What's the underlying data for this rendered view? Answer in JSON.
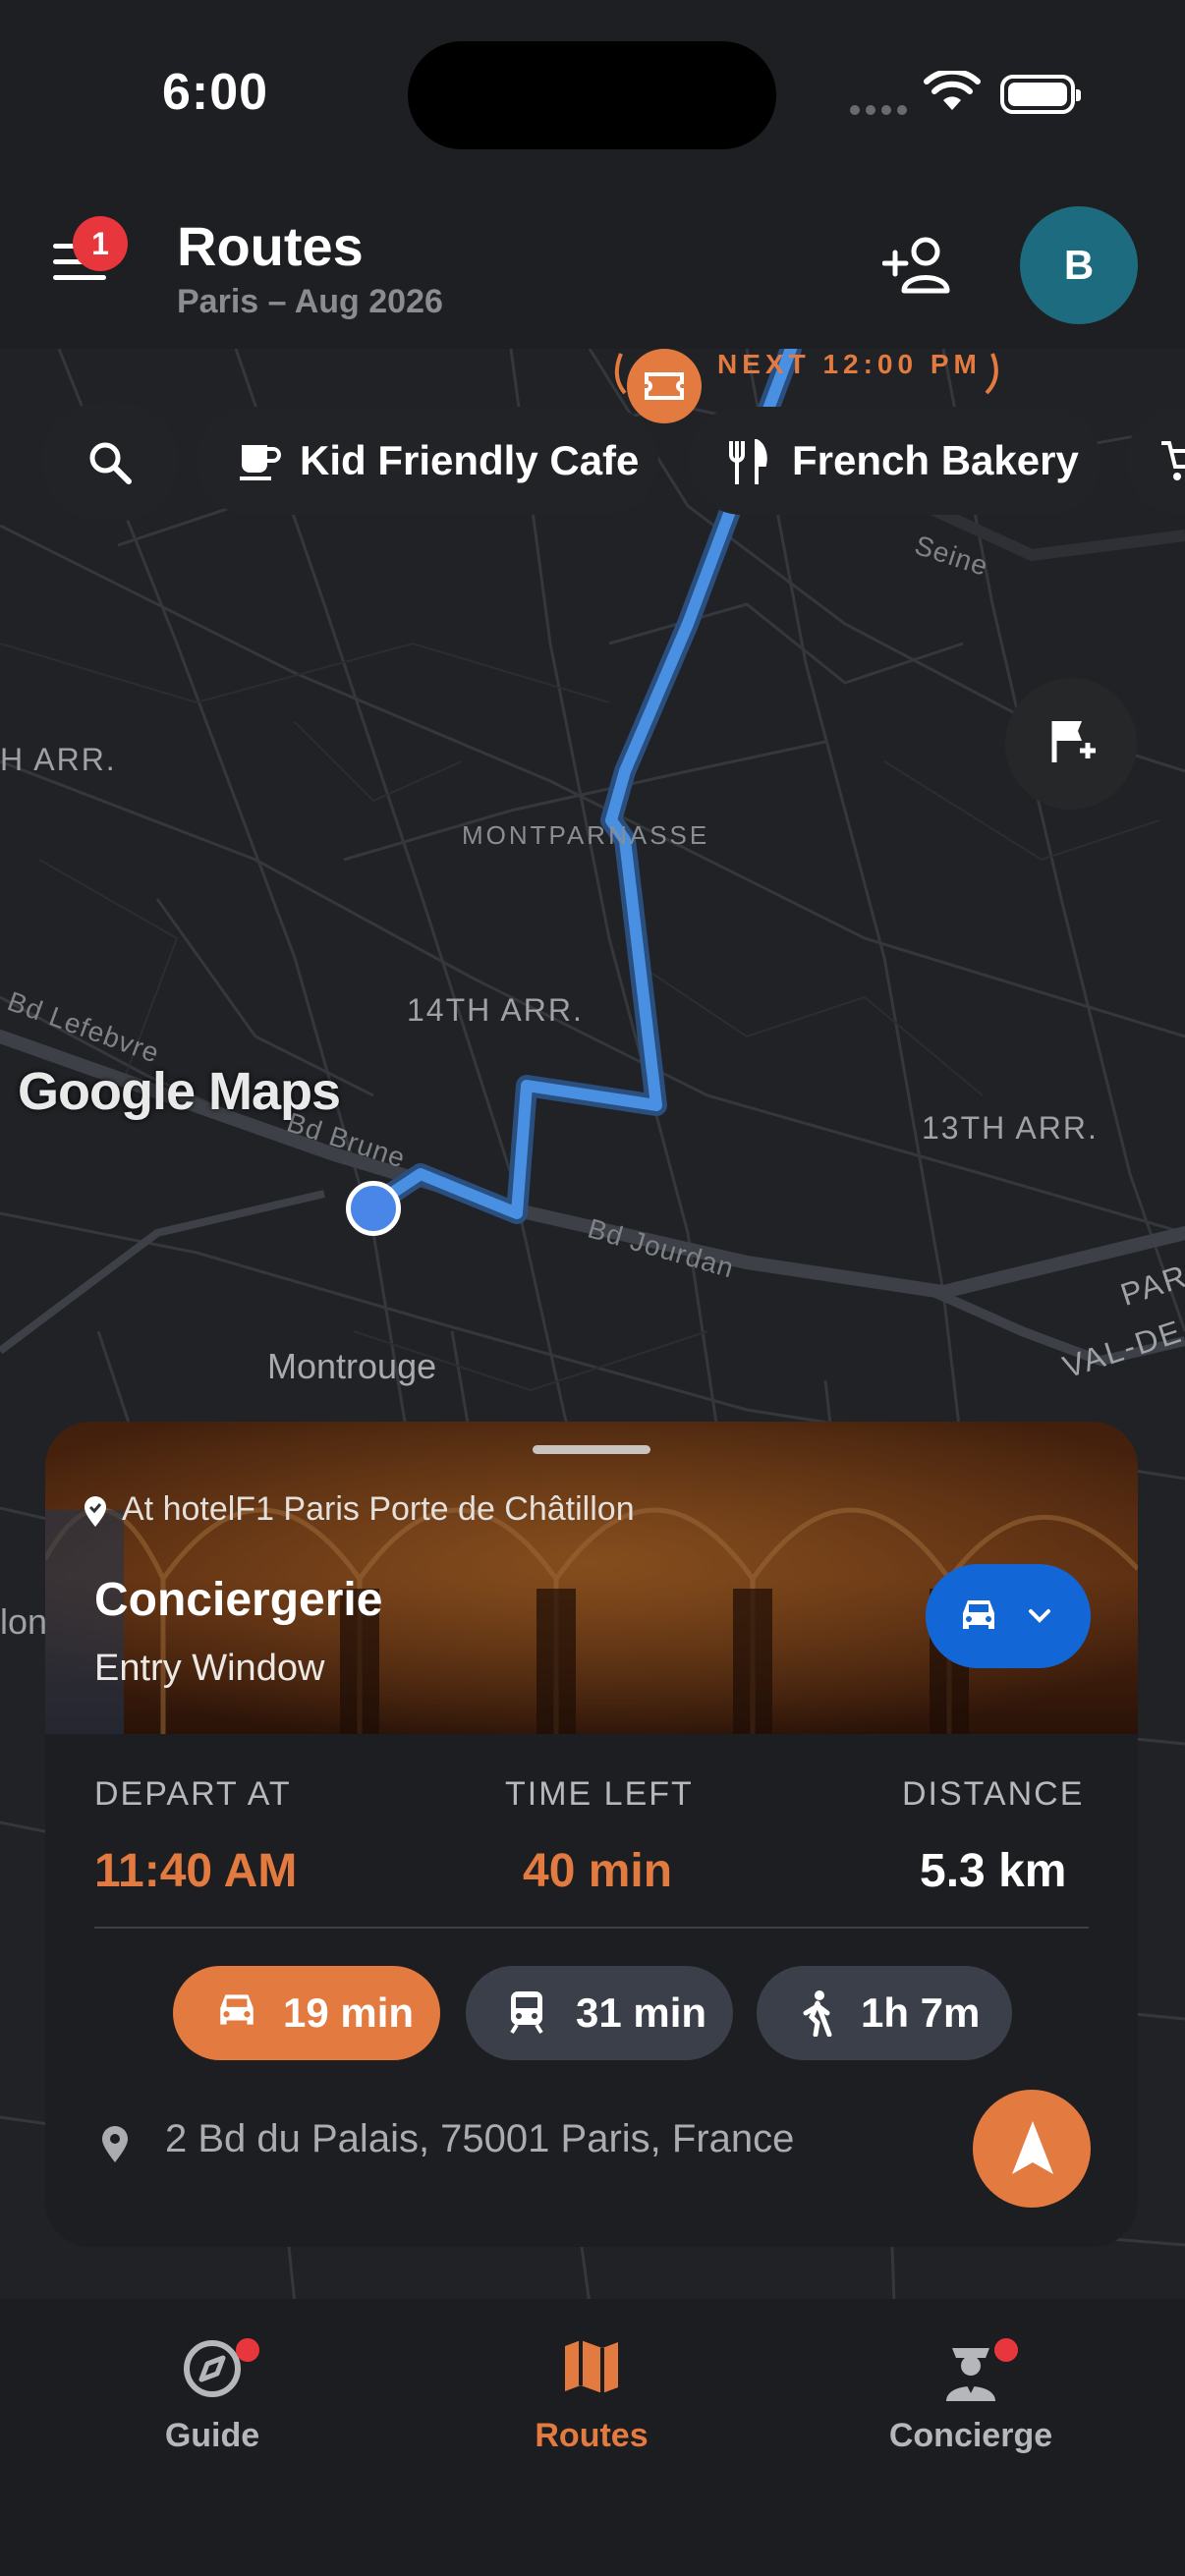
{
  "status_bar": {
    "time": "6:00"
  },
  "header": {
    "title": "Routes",
    "subtitle": "Paris – Aug 2026",
    "notification_count": "1",
    "avatar_initial": "B"
  },
  "next_event": {
    "label": "NEXT 12:00 PM"
  },
  "filter_chips": [
    {
      "label": "Kid Friendly Cafe",
      "icon": "coffee-icon"
    },
    {
      "label": "French Bakery",
      "icon": "utensils-icon"
    }
  ],
  "map": {
    "attribution": "Google Maps",
    "labels": {
      "arr_left": "H ARR.",
      "montparnasse": "MONTPARNASSE",
      "arr14": "14TH ARR.",
      "arr13": "13TH ARR.",
      "montrouge": "Montrouge",
      "seine": "Seine",
      "bd_lefebvre": "Bd Lefebvre",
      "bd_brune": "Bd Brune",
      "bd_jourdan": "Bd Jourdan",
      "par": "PAR",
      "val_de": "VAL-DE",
      "lon": "lon"
    }
  },
  "destination": {
    "start_location": "At hotelF1 Paris Porte de Châtillon",
    "name": "Conciergerie",
    "subtitle": "Entry Window",
    "mode_icon": "car-icon",
    "depart_label": "DEPART AT",
    "depart_value": "11:40 AM",
    "time_left_label": "TIME LEFT",
    "time_left_value": "40 min",
    "distance_label": "DISTANCE",
    "distance_value": "5.3 km",
    "modes": [
      {
        "icon": "car-icon",
        "label": "19 min",
        "active": true
      },
      {
        "icon": "train-icon",
        "label": "31 min",
        "active": false
      },
      {
        "icon": "walk-icon",
        "label": "1h 7m",
        "active": false
      }
    ],
    "address": "2 Bd du Palais, 75001 Paris, France"
  },
  "bottom_nav": [
    {
      "label": "Guide",
      "icon": "compass-icon",
      "active": false,
      "dot": true
    },
    {
      "label": "Routes",
      "icon": "map-icon",
      "active": true,
      "dot": false
    },
    {
      "label": "Concierge",
      "icon": "concierge-icon",
      "active": false,
      "dot": true
    }
  ],
  "colors": {
    "accent": "#e37a40",
    "route": "#4a90e2",
    "mode_button": "#1366d6",
    "badge": "#e8363d"
  }
}
